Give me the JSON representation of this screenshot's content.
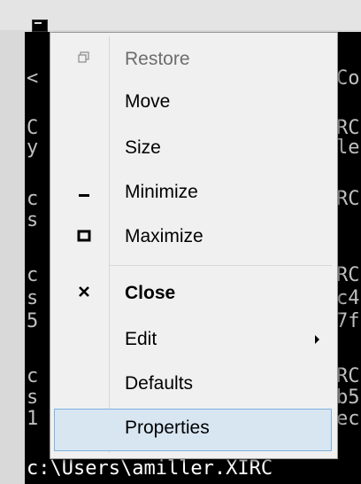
{
  "console": {
    "lines": [
      {
        "left": "<",
        "right": "Co"
      },
      {
        "left": "C",
        "right": "RC"
      },
      {
        "left": "y",
        "right": "le"
      },
      {
        "left": "c",
        "right": "RC"
      },
      {
        "left": "s",
        "right": ""
      },
      {
        "left": "c",
        "right": "RC"
      },
      {
        "left": "s",
        "right": "c4"
      },
      {
        "left": "5",
        "right": "7f"
      },
      {
        "left": "c",
        "right": "RC"
      },
      {
        "left": "s",
        "right": "b5"
      },
      {
        "left": "1",
        "right": "ec"
      }
    ],
    "prompt": "c:\\Users\\amiller.XIRC"
  },
  "menu": {
    "items": [
      {
        "label": "Restore",
        "icon": "restore-icon",
        "disabled": true
      },
      {
        "label": "Move"
      },
      {
        "label": "Size"
      },
      {
        "label": "Minimize",
        "icon": "minimize-icon"
      },
      {
        "label": "Maximize",
        "icon": "maximize-icon"
      },
      {
        "label": "Close",
        "icon": "close-icon",
        "bold": true
      },
      {
        "label": "Edit",
        "submenu": true
      },
      {
        "label": "Defaults"
      },
      {
        "label": "Properties",
        "highlighted": true
      }
    ]
  },
  "colors": {
    "menu_bg": "#f0f0f0",
    "highlight_bg": "#d8e6f2",
    "highlight_border": "#7fb2df",
    "console_bg": "#000000",
    "console_text": "#c0c0c0"
  }
}
